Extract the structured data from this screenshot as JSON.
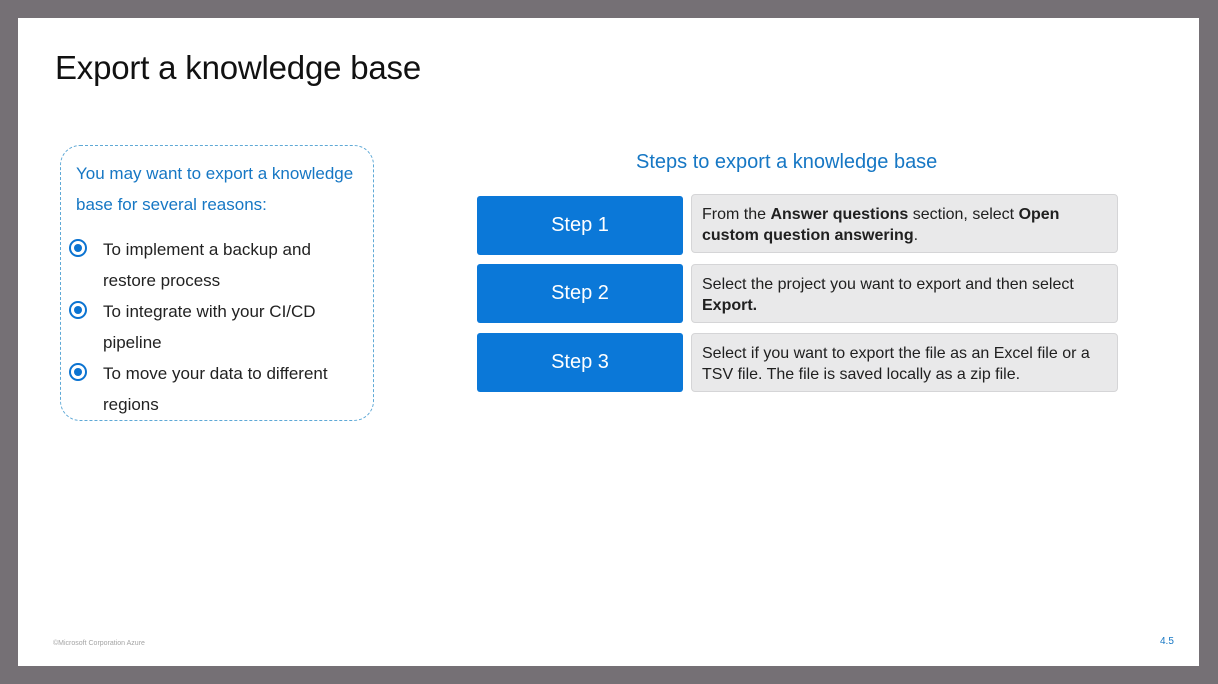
{
  "slide": {
    "title": "Export a knowledge base",
    "footer_copyright": "©Microsoft Corporation Azure",
    "page_number": "4.5"
  },
  "reasons": {
    "intro": "You may want to export a knowledge base for several reasons:",
    "items": [
      {
        "text": "To implement a backup and restore process",
        "icon": "radio-bullet-icon"
      },
      {
        "text": "To integrate with your CI/CD pipeline",
        "icon": "radio-bullet-icon"
      },
      {
        "text": "To move your data to different regions",
        "icon": "radio-bullet-icon"
      }
    ]
  },
  "steps": {
    "heading": "Steps to export a knowledge base",
    "items": [
      {
        "label": "Step 1",
        "parts": [
          {
            "text": "From the "
          },
          {
            "text": "Answer questions",
            "bold": true
          },
          {
            "text": " section, select "
          },
          {
            "text": "Open custom question answering",
            "bold": true
          },
          {
            "text": "."
          }
        ]
      },
      {
        "label": "Step 2",
        "parts": [
          {
            "text": "Select the project you want to export and then select "
          },
          {
            "text": "Export.",
            "bold": true
          }
        ]
      },
      {
        "label": "Step 3",
        "parts": [
          {
            "text": "Select if you want to export the file as an Excel file or a TSV file. The file is saved locally as a zip file."
          }
        ]
      }
    ]
  },
  "colors": {
    "accent_blue": "#0b78d8",
    "heading_blue": "#1677c4",
    "frame_gray": "#757075",
    "step_desc_bg": "#e9e9ea"
  }
}
